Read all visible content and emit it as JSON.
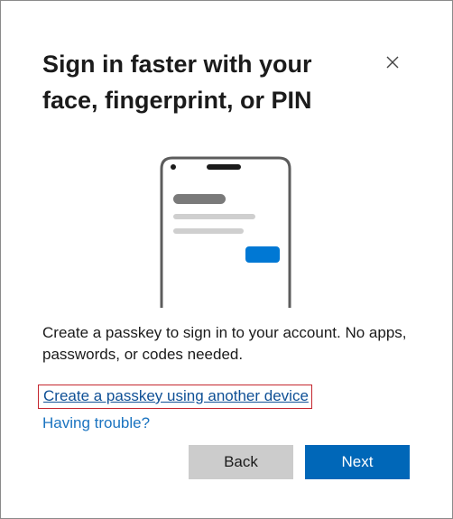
{
  "dialog": {
    "title": "Sign in faster with your face, fingerprint, or PIN",
    "close_icon": "close-icon",
    "description": "Create a passkey to sign in to your account. No apps, passwords, or codes needed.",
    "links": {
      "other_device": "Create a passkey using another device",
      "trouble": "Having trouble?"
    },
    "buttons": {
      "back": "Back",
      "next": "Next"
    },
    "colors": {
      "primary": "#0067b8",
      "secondary": "#cccccc",
      "link": "#1a73c0",
      "highlight_border": "#c4262e"
    }
  }
}
